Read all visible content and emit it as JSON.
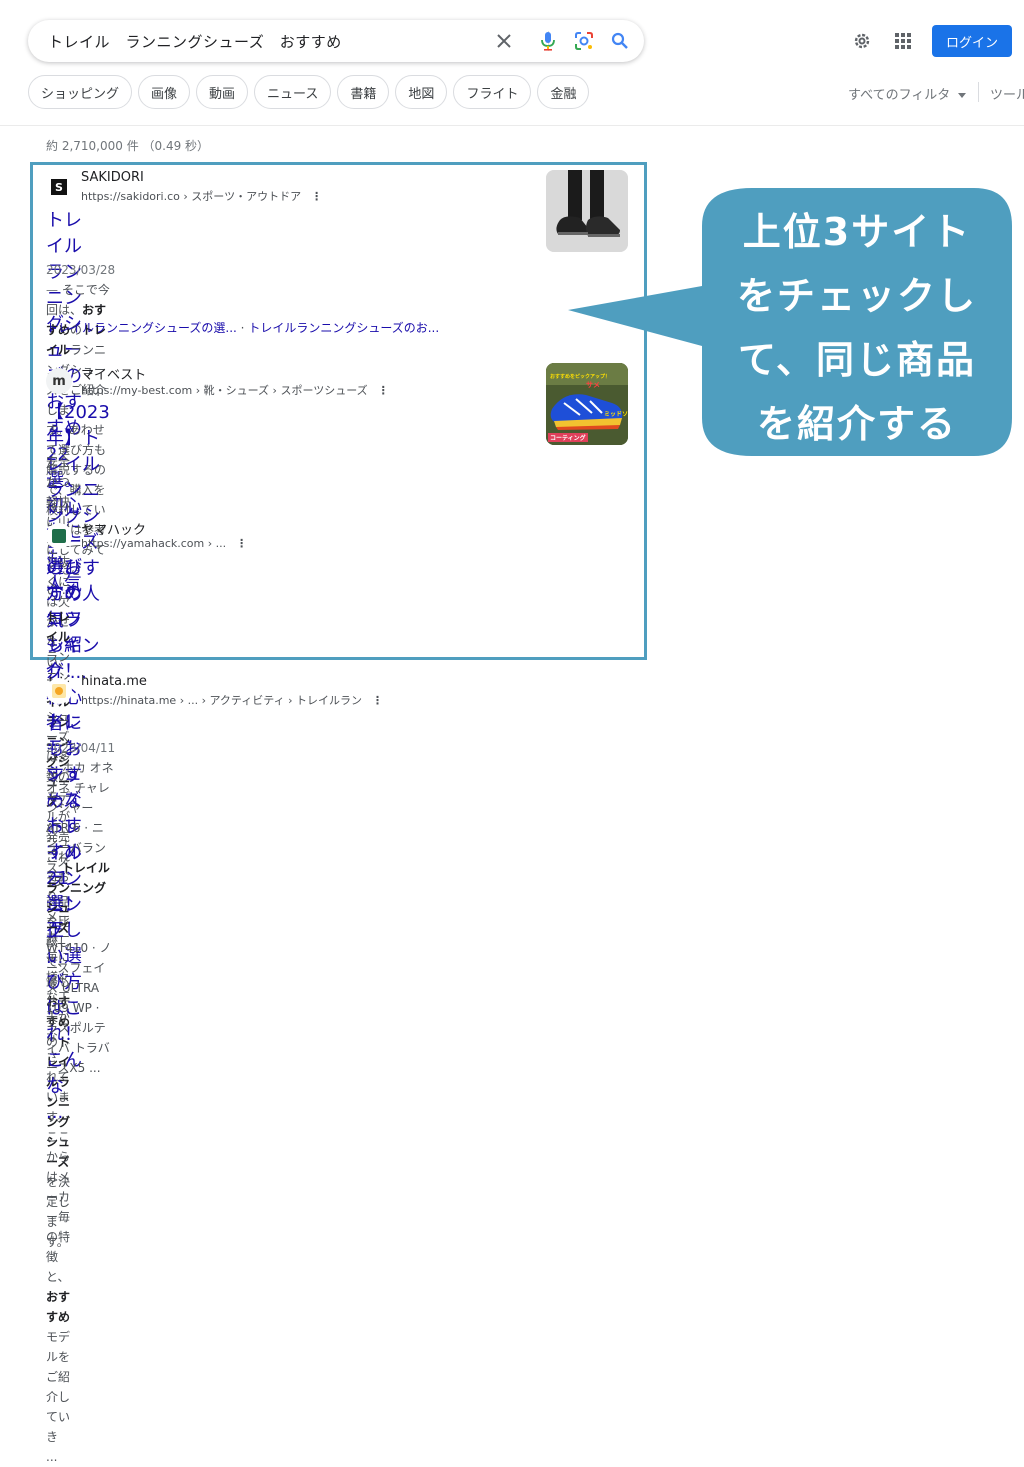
{
  "search": {
    "query": "トレイル　ランニングシューズ　おすすめ"
  },
  "header": {
    "login_label": "ログイン"
  },
  "chips": [
    "ショッピング",
    "画像",
    "動画",
    "ニュース",
    "書籍",
    "地図",
    "フライト",
    "金融"
  ],
  "filters": {
    "all_filters": "すべてのフィルタ",
    "tools": "ツール"
  },
  "stats": "約 2,710,000 件 （0.49 秒）",
  "results": [
    {
      "site_name": "SAKIDORI",
      "url": "https://sakidori.co › スポーツ・アウトドア",
      "title_line1": "トレイルランニングシューズのおすすめ22選。初心者にも",
      "title_line2": "人気 ...",
      "date": "2023/03/28 — ",
      "snippet_a": "そこで今回は、",
      "snippet_b": "おすすめ",
      "snippet_c": "の",
      "snippet_d": "トレイル",
      "snippet_e": "ランニング",
      "snippet_f": "シューズをご紹介しま",
      "snippet_line2": "す。あわせて選び方も解説するので、購入を検討している方は参考にしてみてくださ",
      "snippet_line3": "い ...",
      "sublink1": "トレイルランニングシューズの選...",
      "sublink_sep": " · ",
      "sublink2": "トレイルランニングシューズのお..."
    },
    {
      "site_name": "マイベスト",
      "url": "https://my-best.com › 靴・シューズ › スポーツシューズ",
      "title_line1": "【2023年】トレイルランニングシューズのおすすめ人気ラ",
      "title_line2": "ンキング ...",
      "snippet_a": "安全かつ軽快に山を走り抜くには欠かせない、",
      "snippet_b": "トレイルランニングシューズ",
      "snippet_c": "。 ... シュ",
      "snippet_line2a": "ーズ15商品を比較して、最も",
      "snippet_line2b": "おすすめ",
      "snippet_line2c": "の",
      "snippet_line2d": "トレイルランニングシューズ",
      "snippet_line2e": "を決定します。",
      "thumb_text_top": "おすすめをピックアップ！",
      "thumb_text_mid": "サメ",
      "thumb_text_side": "ミッドソ",
      "thumb_text_bottom": "コーティング"
    },
    {
      "site_name": "ヤマハック",
      "url": "https://yamahack.com › ...",
      "title_line1": "選び方のコツも紹介！初心者にもおすすめなトレイルランニング",
      "title_line2": "...",
      "snippet_a": "トレイル",
      "snippet_b": "ランニング",
      "snippet_c": "シューズは多数のモデルが発売されており、メーカー毎に様々な工夫がな",
      "snippet_line2a": "されています。ここからはメーカー毎の特徴と、",
      "snippet_line2b": "おすすめ",
      "snippet_line2c": "モデルをご紹介していき ..."
    },
    {
      "site_name": "hinata.me",
      "url": "https://hinata.me › ... › アクティビティ › トレイルラン",
      "title_line1": "トレランシューズおすすめ21選！正しい選び方はこれ！こんな ...",
      "date": "2023/04/11 — ",
      "snippet_a": "ホカ オネオネ チャレンジャー ATR 6 · ニューバランス ",
      "snippet_b": "トレイルランニングシュ",
      "snippet_line2a": "ーズ",
      "snippet_line2b": " WT410 · ノースフェイス ULTRA 109 WP · ラスポルティバ トラバースX5 ..."
    }
  ],
  "callout": {
    "line1": "上位3サイト",
    "line2": "をチェックし",
    "line3": "て、同じ商品",
    "line4": "を紹介する",
    "color": "#4f9ebf"
  },
  "icons": [
    "clear-icon",
    "mic-icon",
    "lens-icon",
    "search-icon",
    "settings-gear-icon",
    "apps-grid-icon",
    "more-vert-icon"
  ]
}
